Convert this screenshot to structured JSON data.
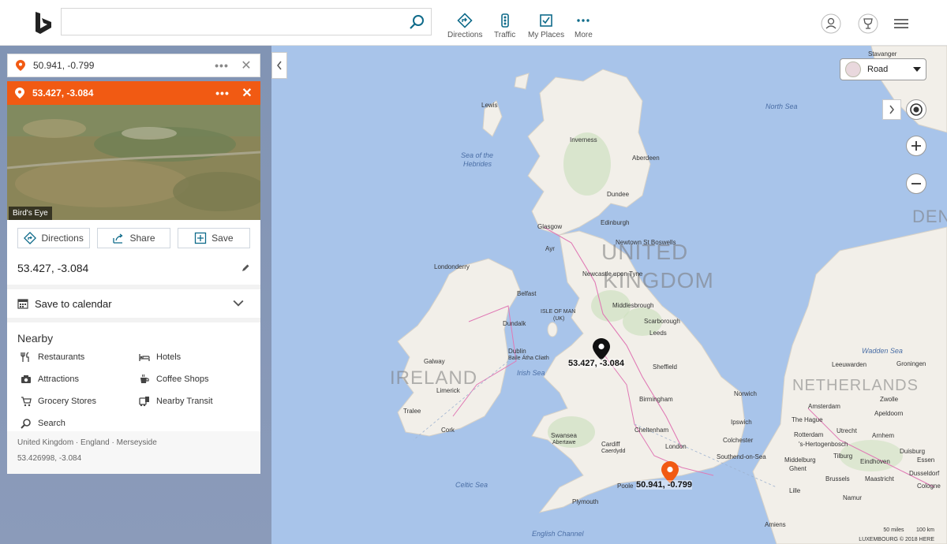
{
  "header": {
    "search_placeholder": "",
    "nav": [
      {
        "label": "Directions"
      },
      {
        "label": "Traffic"
      },
      {
        "label": "My Places"
      },
      {
        "label": "More"
      }
    ]
  },
  "pins": {
    "first": {
      "coords": "50.941, -0.799"
    },
    "second": {
      "coords": "53.427, -3.084"
    }
  },
  "card": {
    "photo_badge": "Bird's Eye",
    "actions": {
      "directions": "Directions",
      "share": "Share",
      "save": "Save"
    },
    "coords": "53.427, -3.084",
    "calendar": "Save to calendar",
    "nearby_title": "Nearby",
    "nearby": [
      "Restaurants",
      "Hotels",
      "Attractions",
      "Coffee Shops",
      "Grocery Stores",
      "Nearby Transit",
      "Search"
    ],
    "location": "United Kingdom · England · Merseyside",
    "precise": "53.426998, -3.084"
  },
  "map": {
    "style": "Road",
    "pin_black_label": "53.427, -3.084",
    "pin_orange_label": "50.941, -0.799",
    "country_labels": [
      "UNITED KINGDOM",
      "IRELAND",
      "NETHERLANDS",
      "DEN"
    ],
    "country_lines": {
      "uk1": "UNITED",
      "uk2": "KINGDOM",
      "nl": "NETHERLANDS"
    },
    "seas": {
      "north": "North Sea",
      "hebrides1": "Sea of the",
      "hebrides2": "Hebrides",
      "irish": "Irish Sea",
      "celtic": "Celtic Sea",
      "channel": "English Channel",
      "wadden": "Wadden Sea"
    },
    "cities": {
      "stavanger": "Stavanger",
      "lewis": "Lewis",
      "inverness": "Inverness",
      "aberdeen": "Aberdeen",
      "dundee": "Dundee",
      "glasgow": "Glasgow",
      "edinburgh": "Edinburgh",
      "boswells": "Newtown St Boswells",
      "ayr": "Ayr",
      "londonderry": "Londonderry",
      "newcastle": "Newcastle upon Tyne",
      "belfast": "Belfast",
      "middlesbrough": "Middlesbrough",
      "iom1": "ISLE OF MAN",
      "iom2": "(UK)",
      "scarborough": "Scarborough",
      "dundalk": "Dundalk",
      "leeds": "Leeds",
      "dublin": "Dublin",
      "dublin_alt": "Baile Átha Cliath",
      "galway": "Galway",
      "sheffield": "Sheffield",
      "limerick": "Limerick",
      "norwich": "Norwich",
      "birmingham": "Birmingham",
      "tralee": "Tralee",
      "ipswich": "Ipswich",
      "cork": "Cork",
      "cheltenham": "Cheltenham",
      "swansea": "Swansea",
      "abertawe": "Abertawe",
      "cardiff": "Cardiff",
      "caerdydd": "Caerdydd",
      "colchester": "Colchester",
      "london": "London",
      "southend": "Southend-on-Sea",
      "poole": "Poole",
      "plymouth": "Plymouth",
      "leeuwarden": "Leeuwarden",
      "groningen": "Groningen",
      "zwolle": "Zwolle",
      "apeldoorn": "Apeldoorn",
      "amsterdam": "Amsterdam",
      "thehague": "The Hague",
      "utrecht": "Utrecht",
      "arnhem": "Arnhem",
      "rotterdam": "Rotterdam",
      "hertogenbosch": "'s-Hertogenbosch",
      "duisburg": "Duisburg",
      "middelburg": "Middelburg",
      "tilburg": "Tilburg",
      "eindhoven": "Eindhoven",
      "essen": "Essen",
      "ghent": "Ghent",
      "brussels": "Brussels",
      "maastricht": "Maastricht",
      "dusseldorf": "Dusseldorf",
      "cologne": "Cologne",
      "lille": "Lille",
      "namur": "Namur",
      "amiens": "Amiens"
    },
    "scale_miles": "50 miles",
    "scale_km": "100 km",
    "copyright": "LUXEMBOURG © 2018 HERE"
  },
  "colors": {
    "accent_orange": "#f15a13",
    "link_blue": "#0f6b8a",
    "water": "#a8c4ea",
    "land": "#f2efe9"
  }
}
